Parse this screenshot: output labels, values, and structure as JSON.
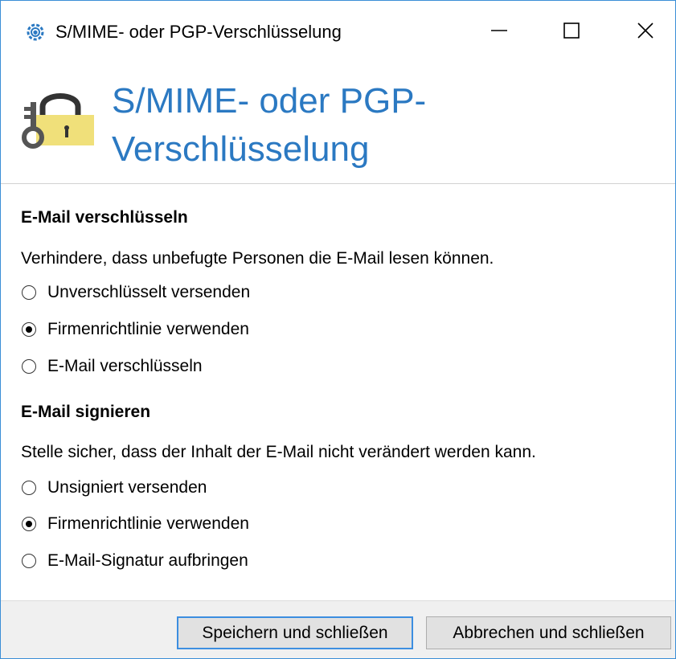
{
  "window": {
    "title": "S/MIME- oder PGP-Verschlüsselung",
    "icon": "gear-shield-icon",
    "controls": [
      "minimize-icon",
      "maximize-icon",
      "close-icon"
    ]
  },
  "header": {
    "icon": "key-lock-icon",
    "title": "S/MIME- oder PGP-Verschlüsselung"
  },
  "encrypt": {
    "title": "E-Mail verschlüsseln",
    "description": "Verhindere, dass unbefugte Personen die E-Mail lesen können.",
    "options": [
      {
        "label": "Unverschlüsselt versenden",
        "checked": false
      },
      {
        "label": "Firmenrichtlinie verwenden",
        "checked": true
      },
      {
        "label": "E-Mail verschlüsseln",
        "checked": false
      }
    ]
  },
  "sign": {
    "title": "E-Mail signieren",
    "description": "Stelle sicher, dass der Inhalt der E-Mail nicht verändert werden kann.",
    "options": [
      {
        "label": "Unsigniert versenden",
        "checked": false
      },
      {
        "label": "Firmenrichtlinie verwenden",
        "checked": true
      },
      {
        "label": "E-Mail-Signatur aufbringen",
        "checked": false
      }
    ]
  },
  "footer": {
    "save_label": "Speichern und schließen",
    "cancel_label": "Abbrechen und schließen"
  },
  "colors": {
    "accent": "#2b79c2",
    "window_border": "#3b8ed6",
    "footer_bg": "#f0f0f0",
    "lock_body": "#f0e07a"
  }
}
